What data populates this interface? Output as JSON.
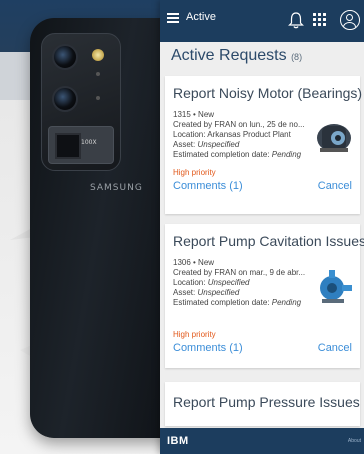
{
  "colors": {
    "header_bg": "#1c3d5e",
    "link": "#3c8ed8",
    "priority": "#e2591b",
    "title": "#2c4a6a"
  },
  "phone": {
    "camera_label": "100X",
    "brand": "SAMSUNG"
  },
  "header": {
    "title": "Active",
    "icons": [
      "menu-icon",
      "bell-icon",
      "apps-grid-icon",
      "user-icon"
    ]
  },
  "section": {
    "title": "Active Requests",
    "count": "(8)"
  },
  "requests": [
    {
      "title": "Report Noisy Motor (Bearings)",
      "id_status": "1315 • New",
      "created": "Created by FRAN on lun., 25 de no...",
      "location_label": "Location:",
      "location_value": "Arkansas Product Plant",
      "asset_label": "Asset:",
      "asset_value": "Unspecified",
      "completion_label": "Estimated completion date:",
      "completion_value": "Pending",
      "priority": "High priority",
      "comments": "Comments (1)",
      "cancel": "Cancel",
      "image": "motor-icon"
    },
    {
      "title": "Report Pump Cavitation Issues",
      "id_status": "1306 • New",
      "created": "Created by FRAN on mar., 9 de abr...",
      "location_label": "Location:",
      "location_value": "Unspecified",
      "asset_label": "Asset:",
      "asset_value": "Unspecified",
      "completion_label": "Estimated completion date:",
      "completion_value": "Pending",
      "priority": "High priority",
      "comments": "Comments (1)",
      "cancel": "Cancel",
      "image": "pump-icon"
    },
    {
      "title": "Report Pump Pressure Issues"
    }
  ],
  "footer": {
    "logo": "IBM",
    "about": "About"
  }
}
